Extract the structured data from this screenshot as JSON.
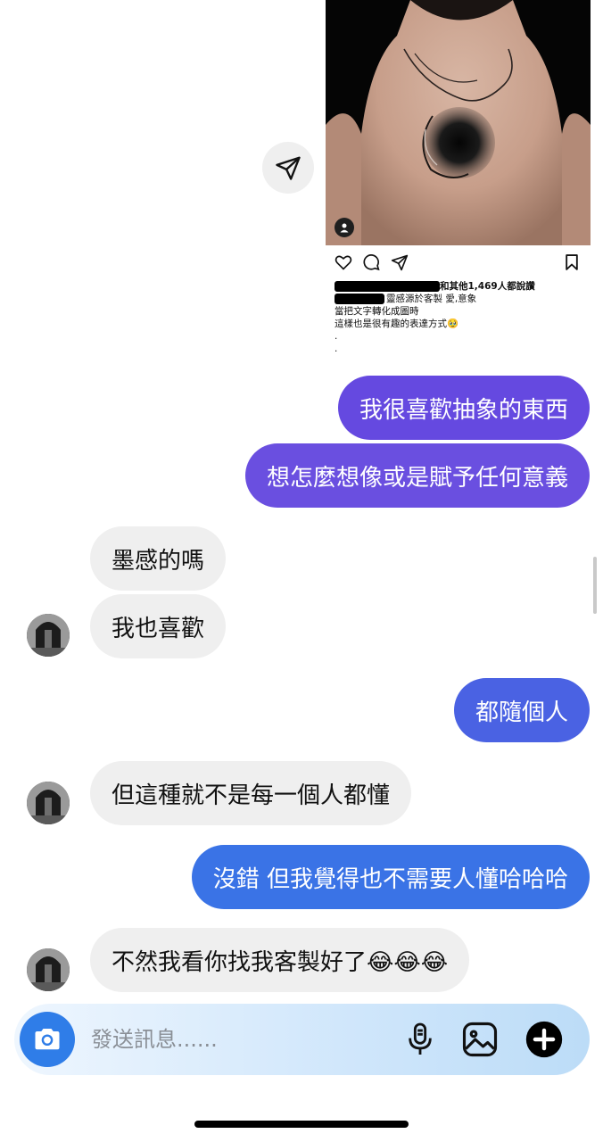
{
  "shared_post": {
    "likes_text": "和其他1,469人都說讚",
    "caption_line1": "靈感源於客製 愛,意象",
    "caption_line2": "當把文字轉化成圖時",
    "caption_line3": "這樣也是很有趣的表達方式🥹",
    "caption_dot1": ".",
    "caption_dot2": "."
  },
  "messages": [
    {
      "id": "m1",
      "sender": "me",
      "text": "我很喜歡抽象的東西",
      "color": "#6549e0"
    },
    {
      "id": "m2",
      "sender": "me",
      "text": "想怎麼想像或是賦予任何意義",
      "color": "#6a4fe0"
    },
    {
      "id": "m3",
      "sender": "them",
      "text": "墨感的嗎"
    },
    {
      "id": "m4",
      "sender": "them",
      "text": "我也喜歡"
    },
    {
      "id": "m5",
      "sender": "me",
      "text": "都隨個人",
      "color": "#4a62e3"
    },
    {
      "id": "m6",
      "sender": "them",
      "text": "但這種就不是每一個人都懂"
    },
    {
      "id": "m7",
      "sender": "me",
      "text": "沒錯 但我覺得也不需要人懂哈哈哈",
      "color": "#3a73e6"
    },
    {
      "id": "m8",
      "sender": "them",
      "text": "不然我看你找我客製好了😂😂😂"
    }
  ],
  "composer": {
    "placeholder": "發送訊息......",
    "camera_icon": "camera-icon",
    "mic_icon": "microphone-icon",
    "gallery_icon": "image-icon",
    "plus_icon": "plus-circle-icon",
    "accent": "#2f7de8"
  },
  "icons": {
    "share": "paper-plane-icon",
    "like": "heart-icon",
    "comment": "comment-icon",
    "send": "send-icon",
    "save": "bookmark-icon",
    "user": "user-tag-icon"
  }
}
